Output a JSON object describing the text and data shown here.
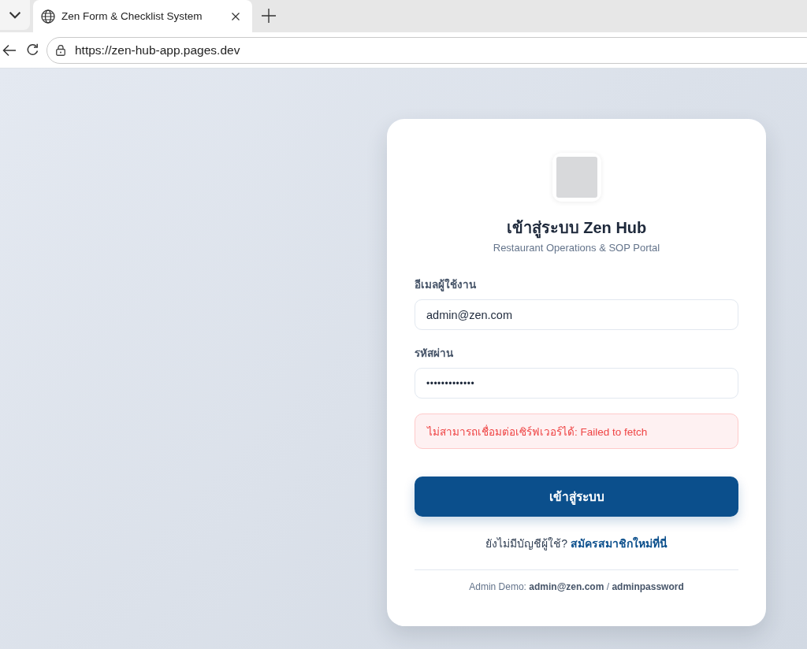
{
  "browser": {
    "tabs": [
      {
        "title": "Zen Form & Checklist System",
        "selected": true
      }
    ],
    "address": "https://zen-hub-app.pages.dev"
  },
  "login_card": {
    "title": "เข้าสู่ระบบ Zen Hub",
    "subtitle": "Restaurant Operations & SOP Portal",
    "fields": [
      {
        "kind": "email",
        "label": "อีเมลผู้ใช้งาน",
        "value": "admin@zen.com"
      },
      {
        "kind": "password",
        "label": "รหัสผ่าน",
        "value": "•••••••••••••"
      }
    ],
    "error": "ไม่สามารถเชื่อมต่อเซิร์ฟเวอร์ได้: Failed to fetch",
    "submit": "เข้าสู่ระบบ",
    "signup_prompt": "ยังไม่มีบัญชีผู้ใช้?",
    "signup_link": "สมัครสมาชิกใหม่ที่นี่",
    "demo_note": "Admin Demo: **admin@zen.com** / **adminpassword**"
  }
}
